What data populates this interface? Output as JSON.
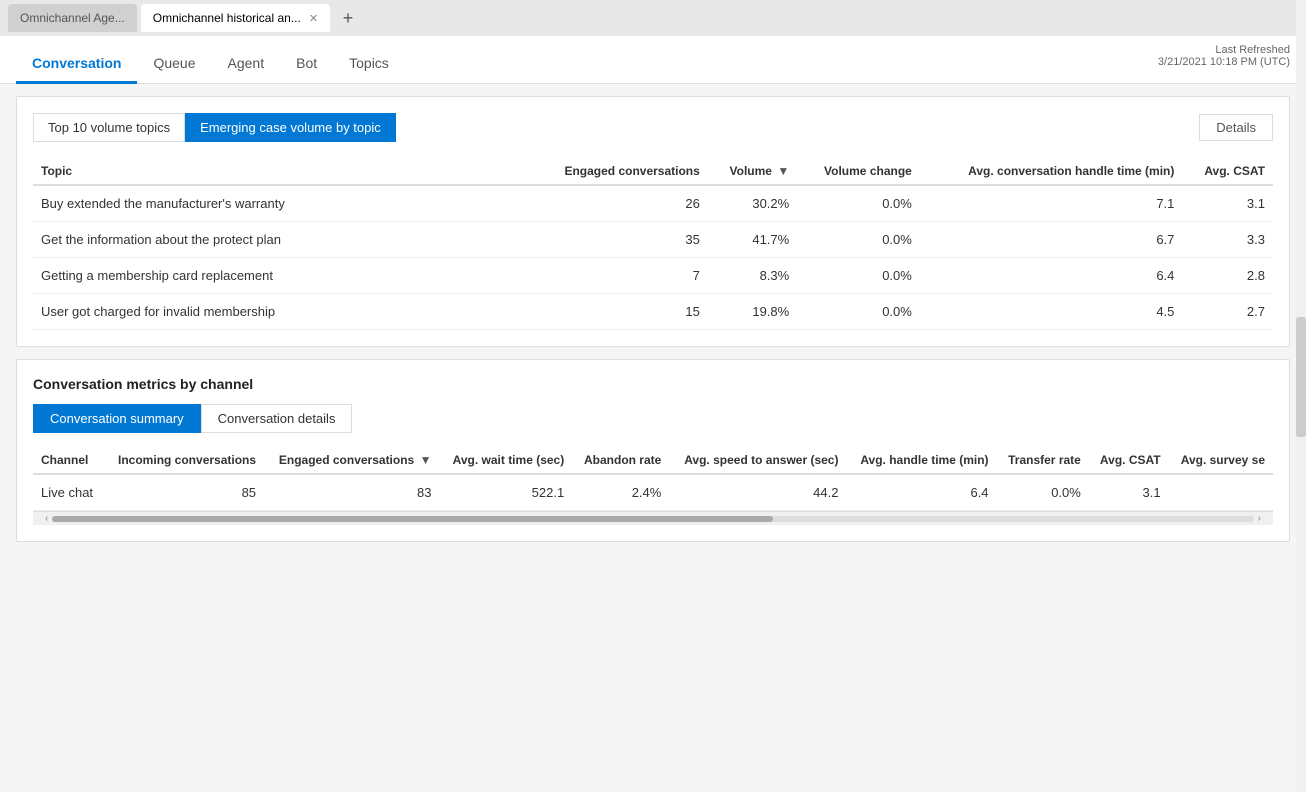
{
  "browser": {
    "tabs": [
      {
        "id": "tab1",
        "label": "Omnichannel Age...",
        "active": false
      },
      {
        "id": "tab2",
        "label": "Omnichannel historical an...",
        "active": true
      }
    ],
    "add_tab_icon": "+"
  },
  "nav": {
    "tabs": [
      {
        "id": "conversation",
        "label": "Conversation",
        "active": true
      },
      {
        "id": "queue",
        "label": "Queue",
        "active": false
      },
      {
        "id": "agent",
        "label": "Agent",
        "active": false
      },
      {
        "id": "bot",
        "label": "Bot",
        "active": false
      },
      {
        "id": "topics",
        "label": "Topics",
        "active": false
      }
    ],
    "last_refreshed_label": "Last Refreshed",
    "last_refreshed_value": "3/21/2021 10:18 PM (UTC)"
  },
  "topics_section": {
    "toggle_buttons": [
      {
        "id": "top10",
        "label": "Top 10 volume topics",
        "active": false
      },
      {
        "id": "emerging",
        "label": "Emerging case volume by topic",
        "active": true
      }
    ],
    "details_button": "Details",
    "table": {
      "columns": [
        {
          "id": "topic",
          "label": "Topic",
          "sortable": false
        },
        {
          "id": "engaged",
          "label": "Engaged conversations",
          "sortable": false
        },
        {
          "id": "volume",
          "label": "Volume",
          "sortable": true,
          "sort_dir": "desc"
        },
        {
          "id": "volume_change",
          "label": "Volume change",
          "sortable": false
        },
        {
          "id": "avg_handle",
          "label": "Avg. conversation handle time (min)",
          "sortable": false
        },
        {
          "id": "avg_csat",
          "label": "Avg. CSAT",
          "sortable": false
        }
      ],
      "rows": [
        {
          "topic": "Buy extended the manufacturer's warranty",
          "engaged": "26",
          "volume": "30.2%",
          "volume_change": "0.0%",
          "avg_handle": "7.1",
          "avg_csat": "3.1"
        },
        {
          "topic": "Get the information about the protect plan",
          "engaged": "35",
          "volume": "41.7%",
          "volume_change": "0.0%",
          "avg_handle": "6.7",
          "avg_csat": "3.3"
        },
        {
          "topic": "Getting a membership card replacement",
          "engaged": "7",
          "volume": "8.3%",
          "volume_change": "0.0%",
          "avg_handle": "6.4",
          "avg_csat": "2.8"
        },
        {
          "topic": "User got charged for invalid membership",
          "engaged": "15",
          "volume": "19.8%",
          "volume_change": "0.0%",
          "avg_handle": "4.5",
          "avg_csat": "2.7"
        }
      ]
    }
  },
  "conv_metrics": {
    "section_title": "Conversation metrics by channel",
    "tabs": [
      {
        "id": "summary",
        "label": "Conversation summary",
        "active": true
      },
      {
        "id": "details",
        "label": "Conversation details",
        "active": false
      }
    ],
    "summary_table": {
      "columns": [
        {
          "id": "channel",
          "label": "Channel"
        },
        {
          "id": "incoming",
          "label": "Incoming conversations"
        },
        {
          "id": "engaged",
          "label": "Engaged conversations",
          "sortable": true,
          "sort_dir": "desc"
        },
        {
          "id": "avg_wait",
          "label": "Avg. wait time (sec)"
        },
        {
          "id": "abandon_rate",
          "label": "Abandon rate"
        },
        {
          "id": "avg_speed",
          "label": "Avg. speed to answer (sec)"
        },
        {
          "id": "avg_handle",
          "label": "Avg. handle time (min)"
        },
        {
          "id": "transfer_rate",
          "label": "Transfer rate"
        },
        {
          "id": "avg_csat",
          "label": "Avg. CSAT"
        },
        {
          "id": "avg_survey",
          "label": "Avg. survey se"
        }
      ],
      "rows": [
        {
          "channel": "Live chat",
          "incoming": "85",
          "engaged": "83",
          "avg_wait": "522.1",
          "abandon_rate": "2.4%",
          "avg_speed": "44.2",
          "avg_handle": "6.4",
          "transfer_rate": "0.0%",
          "avg_csat": "3.1",
          "avg_survey": ""
        }
      ]
    }
  },
  "bottom_scroll": {
    "left_arrow": "‹",
    "right_arrow": "›"
  }
}
